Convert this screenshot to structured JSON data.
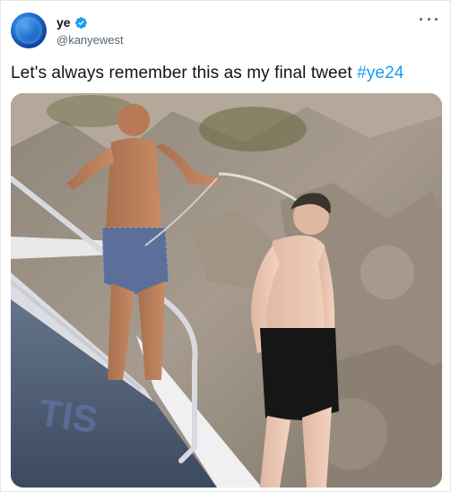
{
  "tweet": {
    "display_name": "ye",
    "handle": "@kanyewest",
    "verified": true,
    "text_prefix": "Let's always remember this as my final tweet ",
    "hashtag": "#ye24"
  },
  "icons": {
    "avatar": "avatar-image",
    "verified": "verified-badge-icon",
    "more": "more-options-icon"
  },
  "colors": {
    "accent": "#1d9bf0",
    "text": "#0f1419",
    "secondary": "#536471"
  }
}
